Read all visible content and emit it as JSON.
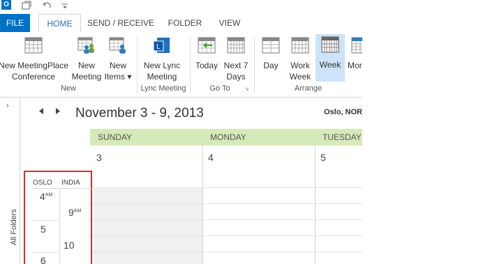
{
  "tabs": [
    "FILE",
    "HOME",
    "SEND / RECEIVE",
    "FOLDER",
    "VIEW"
  ],
  "ribbon": {
    "new_meetingplace": [
      "New MeetingPlace",
      "Conference"
    ],
    "new_meeting": [
      "New",
      "Meeting"
    ],
    "new_items": [
      "New",
      "Items ▾"
    ],
    "new_lync": [
      "New Lync",
      "Meeting"
    ],
    "today": "Today",
    "next7": [
      "Next 7",
      "Days"
    ],
    "day": "Day",
    "work_week": [
      "Work",
      "Week"
    ],
    "week": "Week",
    "month": "Mor",
    "groups": {
      "new": "New",
      "lync": "Lync Meeting",
      "goto": "Go To",
      "arrange": "Arrange"
    }
  },
  "folder_pane": {
    "chevron": "›",
    "label": "All Folders"
  },
  "calendar": {
    "title": "November 3 - 9, 2013",
    "location": "Oslo, NOR",
    "days": [
      {
        "name": "SUNDAY",
        "num": "3"
      },
      {
        "name": "MONDAY",
        "num": "4"
      },
      {
        "name": "TUESDAY",
        "num": "5"
      }
    ],
    "timezones": {
      "primary": "OSLO",
      "secondary": "INDIA"
    },
    "oslo_times": [
      {
        "h": "4",
        "ampm": "AM"
      },
      {
        "h": "5",
        "ampm": ""
      },
      {
        "h": "6",
        "ampm": ""
      }
    ],
    "india_times": [
      {
        "h": "9",
        "ampm": "AM"
      },
      {
        "h": "10",
        "ampm": ""
      }
    ]
  },
  "colors": {
    "accent": "#0072c6",
    "day_header": "#d6eab9",
    "highlight_box": "#d92b2b",
    "selected_btn": "#cde3f7"
  }
}
